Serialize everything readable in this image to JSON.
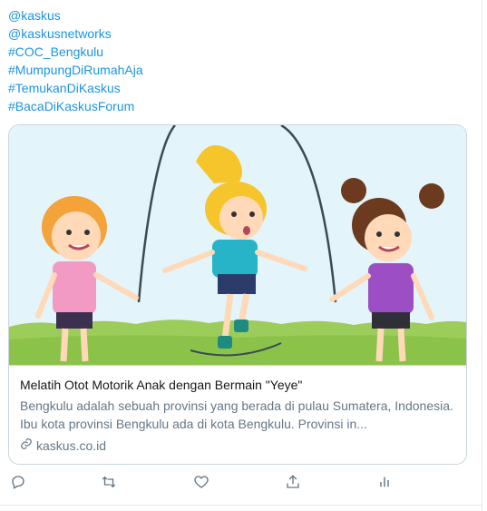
{
  "tweet": {
    "hashtags": [
      "@kaskus",
      "@kaskusnetworks",
      "#COC_Bengkulu",
      "#MumpungDiRumahAja",
      "#TemukanDiKaskus",
      "#BacaDiKaskusForum"
    ],
    "card": {
      "title": "Melatih Otot Motorik Anak dengan Bermain \"Yeye\"",
      "description": "Bengkulu adalah sebuah provinsi yang berada di pulau Sumatera, Indonesia. Ibu kota provinsi Bengkulu ada di kota Bengkulu. Provinsi in...",
      "domain": "kaskus.co.id"
    },
    "actions": {
      "reply_icon": "reply-icon",
      "retweet_icon": "retweet-icon",
      "like_icon": "heart-icon",
      "share_icon": "share-icon",
      "analytics_icon": "analytics-icon"
    }
  },
  "colors": {
    "link": "#1b95e0",
    "text": "#14171a",
    "muted": "#657786",
    "border": "#ccd6dd"
  }
}
